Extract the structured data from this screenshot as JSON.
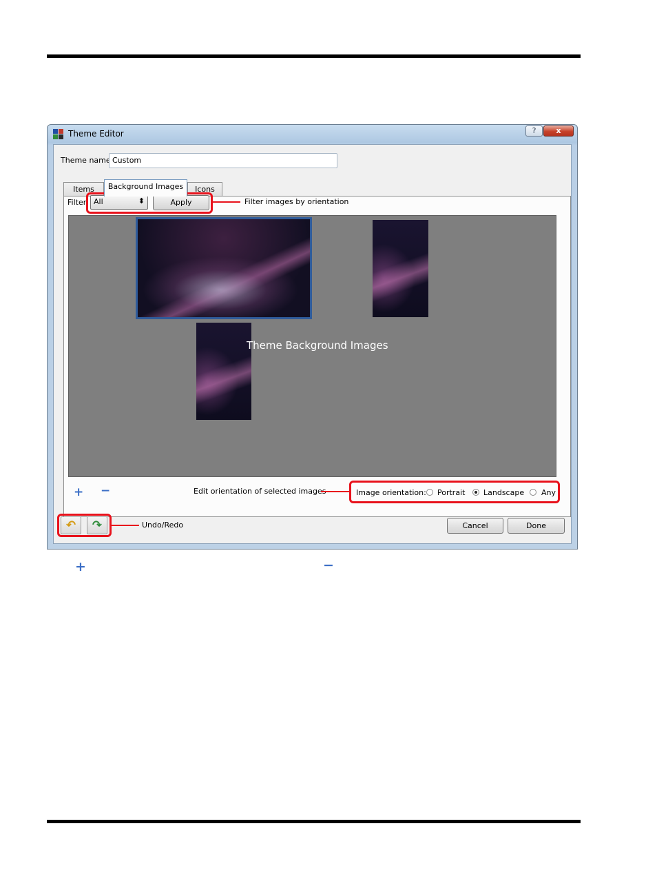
{
  "window": {
    "title": "Theme Editor",
    "help_label": "?",
    "close_label": "x"
  },
  "theme_name": {
    "label": "Theme name",
    "value": "Custom"
  },
  "tabs": [
    {
      "label": "Items",
      "active": false
    },
    {
      "label": "Background Images",
      "active": true
    },
    {
      "label": "Icons",
      "active": false
    }
  ],
  "filter": {
    "label": "Filter",
    "selected": "All",
    "apply_label": "Apply"
  },
  "image_area": {
    "caption": "Theme  Background Images"
  },
  "orientation": {
    "label": "Image orientation:",
    "options": [
      {
        "label": "Portrait",
        "selected": false
      },
      {
        "label": "Landscape",
        "selected": true
      },
      {
        "label": "Any",
        "selected": false
      }
    ]
  },
  "buttons": {
    "cancel": "Cancel",
    "done": "Done"
  },
  "callouts": {
    "filter": "Filter images by orientation",
    "orientation": "Edit orientation of selected images",
    "undo_redo": "Undo/Redo"
  },
  "colors": {
    "highlight": "#e8121c",
    "selection": "#2f5b9a",
    "image_area_bg": "#7f7f7f"
  }
}
